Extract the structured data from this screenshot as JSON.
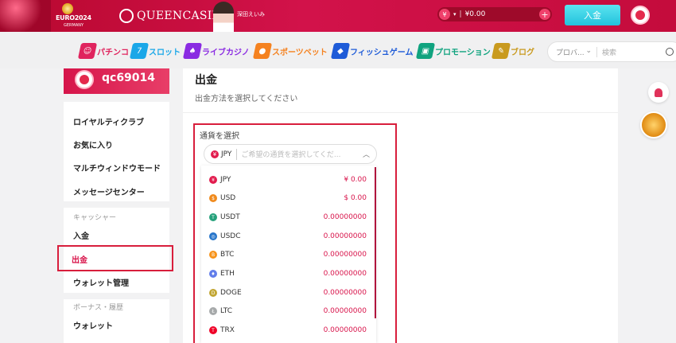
{
  "topbar": {
    "euro_logo": "EURO2024",
    "euro_sub": "GERMANY",
    "brand": "QUEENCASINO",
    "ambassador_caption": "深田えいみ",
    "balance_currency_icon": "¥",
    "balance_amount": "¥0.00",
    "plus_label": "+",
    "deposit_label": "入金"
  },
  "nav": {
    "items": [
      {
        "label": "パチンコ",
        "color": "#e0245e",
        "icon": "slot-face-icon"
      },
      {
        "label": "スロット",
        "color": "#1aa7e8",
        "icon": "777-icon"
      },
      {
        "label": "ライブカジノ",
        "color": "#8a2be2",
        "icon": "spade-icon"
      },
      {
        "label": "スポーツベット",
        "color": "#f58220",
        "icon": "ball-icon"
      },
      {
        "label": "フィッシュゲーム",
        "color": "#1e5bd8",
        "icon": "fish-icon"
      },
      {
        "label": "プロモーション",
        "color": "#10a37f",
        "icon": "gift-icon"
      },
      {
        "label": "ブログ",
        "color": "#c99a1e",
        "icon": "chat-icon"
      }
    ],
    "provider_label": "プロバ...",
    "search_placeholder": "検索"
  },
  "sidebar": {
    "username": "qc69014",
    "items": [
      {
        "label": "ロイヤルティクラブ"
      },
      {
        "label": "お気に入り"
      },
      {
        "label": "マルチウィンドウモード"
      },
      {
        "label": "メッセージセンター"
      }
    ],
    "cashier_section": "キャッシャー",
    "cashier_items": [
      {
        "label": "入金"
      },
      {
        "label": "出金"
      },
      {
        "label": "ウォレット管理"
      }
    ],
    "bonus_section": "ボーナス・履歴",
    "bonus_items": [
      {
        "label": "ウォレット"
      }
    ]
  },
  "main": {
    "title": "出金",
    "subtitle": "出金方法を選択してください",
    "currency_label": "通貨を選択",
    "selected_code": "JPY",
    "selected_badge": "¥",
    "currency_placeholder": "ご希望の通貨を選択してくだ...",
    "currencies": [
      {
        "code": "JPY",
        "amount": "¥ 0.00",
        "color": "#e21c4e",
        "glyph": "¥"
      },
      {
        "code": "USD",
        "amount": "$ 0.00",
        "color": "#f08a1c",
        "glyph": "$"
      },
      {
        "code": "USDT",
        "amount": "0.00000000",
        "color": "#26a17b",
        "glyph": "T"
      },
      {
        "code": "USDC",
        "amount": "0.00000000",
        "color": "#2775ca",
        "glyph": "◎"
      },
      {
        "code": "BTC",
        "amount": "0.00000000",
        "color": "#f7931a",
        "glyph": "B"
      },
      {
        "code": "ETH",
        "amount": "0.00000000",
        "color": "#627eea",
        "glyph": "♦"
      },
      {
        "code": "DOGE",
        "amount": "0.00000000",
        "color": "#c2a633",
        "glyph": "D"
      },
      {
        "code": "LTC",
        "amount": "0.00000000",
        "color": "#a6a9aa",
        "glyph": "Ł"
      },
      {
        "code": "TRX",
        "amount": "0.00000000",
        "color": "#ef0027",
        "glyph": "T"
      }
    ]
  }
}
